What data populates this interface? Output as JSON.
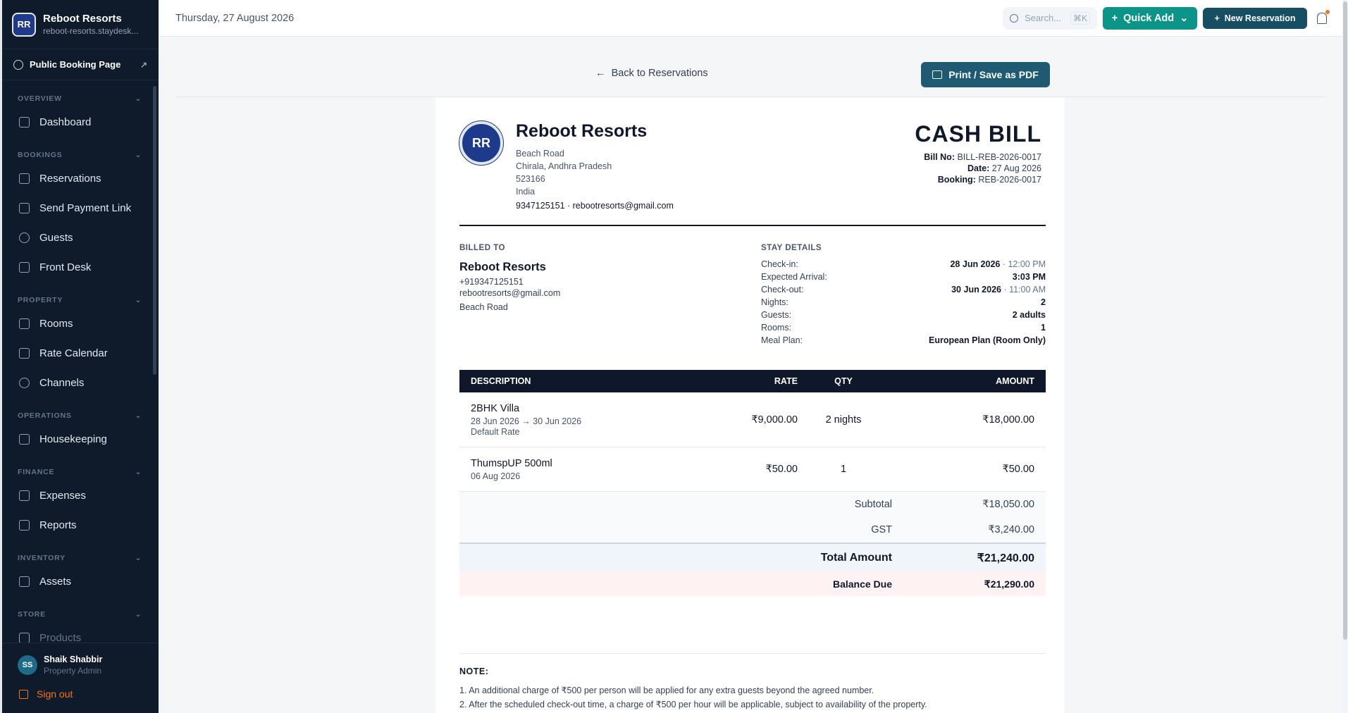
{
  "sidebar": {
    "brand_name": "Reboot Resorts",
    "brand_url": "reboot-resorts.staydesk...",
    "brand_logo": "RR",
    "public_booking": "Public Booking Page",
    "sections": {
      "overview": "OVERVIEW",
      "bookings": "BOOKINGS",
      "property": "PROPERTY",
      "operations": "OPERATIONS",
      "finance": "FINANCE",
      "inventory": "INVENTORY",
      "store": "STORE"
    },
    "items": {
      "dashboard": "Dashboard",
      "reservations": "Reservations",
      "send_payment_link": "Send Payment Link",
      "guests": "Guests",
      "front_desk": "Front Desk",
      "rooms": "Rooms",
      "rate_calendar": "Rate Calendar",
      "channels": "Channels",
      "housekeeping": "Housekeeping",
      "expenses": "Expenses",
      "reports": "Reports",
      "assets": "Assets",
      "products": "Products"
    },
    "user": {
      "initials": "SS",
      "name": "Shaik Shabbir",
      "role": "Property Admin"
    },
    "sign_out": "Sign out"
  },
  "topbar": {
    "date": "Thursday, 27 August 2026",
    "search_placeholder": "Search...",
    "search_shortcut": "⌘K",
    "quick_add": "Quick Add",
    "new_reservation": "New Reservation"
  },
  "page": {
    "back": "Back to Reservations",
    "print": "Print / Save as PDF"
  },
  "bill": {
    "business": {
      "name": "Reboot Resorts",
      "address1": "Beach Road",
      "address2": "Chirala, Andhra Pradesh",
      "postcode": "523166",
      "country": "India",
      "contact": "9347125151 · rebootresorts@gmail.com"
    },
    "title": "CASH BILL",
    "bill_no_label": "Bill No:",
    "bill_no": "BILL-REB-2026-0017",
    "date_label": "Date:",
    "date": "27 Aug 2026",
    "booking_label": "Booking:",
    "booking": "REB-2026-0017",
    "billed_to": {
      "label": "BILLED TO",
      "name": "Reboot Resorts",
      "phone": "+919347125151",
      "email": "rebootresorts@gmail.com",
      "address": "Beach Road"
    },
    "stay": {
      "label": "STAY DETAILS",
      "checkin_label": "Check-in:",
      "checkin_date": "28 Jun 2026",
      "checkin_time": " · 12:00 PM",
      "arrival_label": "Expected Arrival:",
      "arrival": "3:03 PM",
      "checkout_label": "Check-out:",
      "checkout_date": "30 Jun 2026",
      "checkout_time": " · 11:00 AM",
      "nights_label": "Nights:",
      "nights": "2",
      "guests_label": "Guests:",
      "guests": "2 adults",
      "rooms_label": "Rooms:",
      "rooms": "1",
      "meal_label": "Meal Plan:",
      "meal": "European Plan (Room Only)"
    },
    "table": {
      "headers": {
        "description": "DESCRIPTION",
        "rate": "RATE",
        "qty": "QTY",
        "amount": "AMOUNT"
      },
      "rows": [
        {
          "name": "2BHK Villa",
          "sub1": "28 Jun 2026 → 30 Jun 2026",
          "sub2": "Default Rate",
          "rate": "₹9,000.00",
          "qty": "2 nights",
          "amount": "₹18,000.00"
        },
        {
          "name": "ThumspUP 500ml",
          "sub1": "06 Aug 2026",
          "rate": "₹50.00",
          "qty": "1",
          "amount": "₹50.00"
        }
      ],
      "subtotal_label": "Subtotal",
      "subtotal": "₹18,050.00",
      "gst_label": "GST",
      "gst": "₹3,240.00",
      "total_label": "Total Amount",
      "total": "₹21,240.00",
      "due_label": "Balance Due",
      "due": "₹21,290.00"
    },
    "notes": {
      "title": "NOTE:",
      "lines": [
        "1. An additional charge of ₹500 per person will be applied for any extra guests beyond the agreed number.",
        "2. After the scheduled check-out time, a charge of ₹500 per hour will be applicable, subject to availability of the property."
      ]
    }
  }
}
